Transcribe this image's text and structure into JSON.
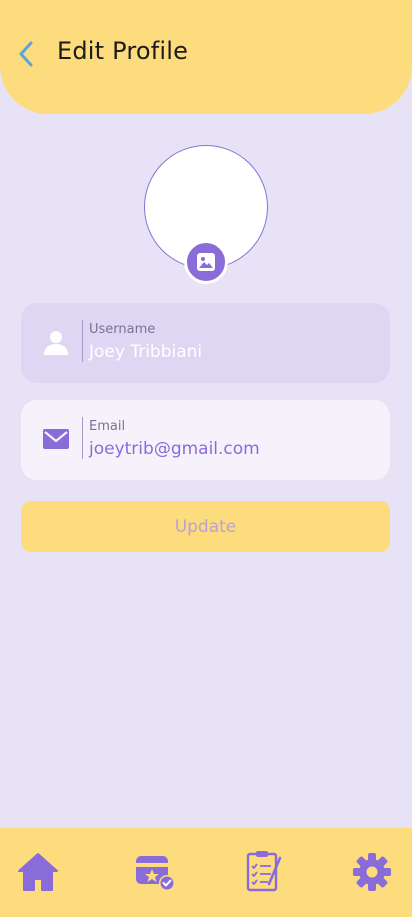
{
  "header": {
    "title": "Edit Profile",
    "back_icon": "chevron-left-icon"
  },
  "avatar": {
    "edit_icon": "image-icon"
  },
  "form": {
    "username": {
      "label": "Username",
      "value": "Joey Tribbiani",
      "icon": "user-icon"
    },
    "email": {
      "label": "Email",
      "value": "joeytrib@gmail.com",
      "icon": "mail-icon"
    },
    "update_label": "Update"
  },
  "nav": {
    "items": [
      {
        "icon": "home-icon"
      },
      {
        "icon": "event-card-check-icon"
      },
      {
        "icon": "checklist-icon"
      },
      {
        "icon": "gear-icon"
      }
    ]
  },
  "colors": {
    "background": "#e8e2f6",
    "header": "#fddc7e",
    "accent": "#8a6cd8",
    "back_arrow": "#5aa4d6"
  }
}
